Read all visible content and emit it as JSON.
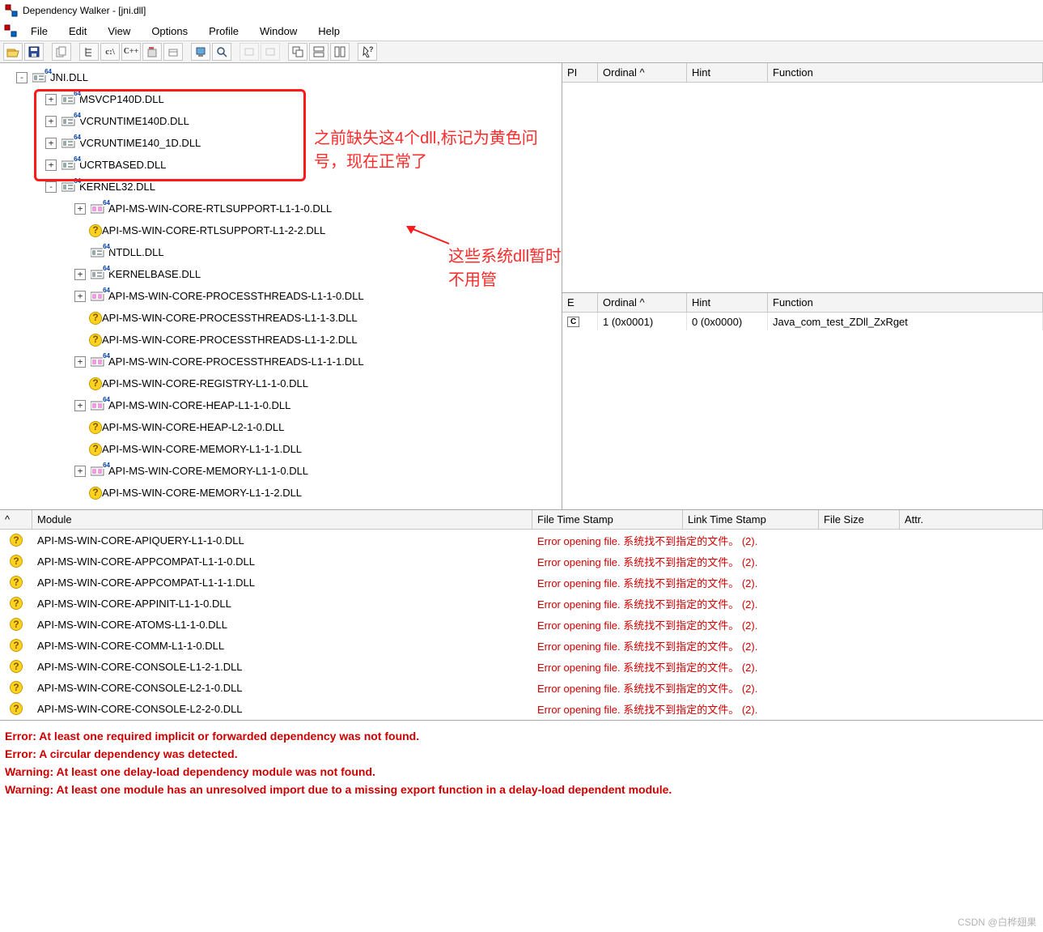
{
  "title": "Dependency Walker - [jni.dll]",
  "menubar": [
    "File",
    "Edit",
    "View",
    "Options",
    "Profile",
    "Window",
    "Help"
  ],
  "tree": [
    {
      "d": 0,
      "exp": "-",
      "icon": "mod64",
      "label": "JNI.DLL"
    },
    {
      "d": 1,
      "exp": "+",
      "icon": "mod64",
      "label": "MSVCP140D.DLL",
      "boxed": true
    },
    {
      "d": 1,
      "exp": "+",
      "icon": "mod64",
      "label": "VCRUNTIME140D.DLL",
      "boxed": true
    },
    {
      "d": 1,
      "exp": "+",
      "icon": "mod64",
      "label": "VCRUNTIME140_1D.DLL",
      "boxed": true
    },
    {
      "d": 1,
      "exp": "+",
      "icon": "mod64",
      "label": "UCRTBASED.DLL",
      "boxed": true
    },
    {
      "d": 1,
      "exp": "-",
      "icon": "mod64",
      "label": "KERNEL32.DLL"
    },
    {
      "d": 2,
      "exp": "+",
      "icon": "link64",
      "label": "API-MS-WIN-CORE-RTLSUPPORT-L1-1-0.DLL"
    },
    {
      "d": 2,
      "exp": " ",
      "icon": "q",
      "label": "API-MS-WIN-CORE-RTLSUPPORT-L1-2-2.DLL"
    },
    {
      "d": 2,
      "exp": " ",
      "icon": "mod64",
      "label": "NTDLL.DLL"
    },
    {
      "d": 2,
      "exp": "+",
      "icon": "mod64",
      "label": "KERNELBASE.DLL"
    },
    {
      "d": 2,
      "exp": "+",
      "icon": "link64",
      "label": "API-MS-WIN-CORE-PROCESSTHREADS-L1-1-0.DLL"
    },
    {
      "d": 2,
      "exp": " ",
      "icon": "q",
      "label": "API-MS-WIN-CORE-PROCESSTHREADS-L1-1-3.DLL"
    },
    {
      "d": 2,
      "exp": " ",
      "icon": "q",
      "label": "API-MS-WIN-CORE-PROCESSTHREADS-L1-1-2.DLL"
    },
    {
      "d": 2,
      "exp": "+",
      "icon": "link64",
      "label": "API-MS-WIN-CORE-PROCESSTHREADS-L1-1-1.DLL"
    },
    {
      "d": 2,
      "exp": " ",
      "icon": "q",
      "label": "API-MS-WIN-CORE-REGISTRY-L1-1-0.DLL"
    },
    {
      "d": 2,
      "exp": "+",
      "icon": "link64",
      "label": "API-MS-WIN-CORE-HEAP-L1-1-0.DLL"
    },
    {
      "d": 2,
      "exp": " ",
      "icon": "q",
      "label": "API-MS-WIN-CORE-HEAP-L2-1-0.DLL"
    },
    {
      "d": 2,
      "exp": " ",
      "icon": "q",
      "label": "API-MS-WIN-CORE-MEMORY-L1-1-1.DLL"
    },
    {
      "d": 2,
      "exp": "+",
      "icon": "link64",
      "label": "API-MS-WIN-CORE-MEMORY-L1-1-0.DLL"
    },
    {
      "d": 2,
      "exp": " ",
      "icon": "q",
      "label": "API-MS-WIN-CORE-MEMORY-L1-1-2.DLL"
    }
  ],
  "annot1": "之前缺失这4个dll,标记为黄色问号，现在正常了",
  "annot2": "这些系统dll暂时不用管",
  "grid_top_cols": [
    "PI",
    "Ordinal ^",
    "Hint",
    "Function"
  ],
  "grid_bot_cols": [
    "E",
    "Ordinal ^",
    "Hint",
    "Function"
  ],
  "grid_bot_row": {
    "e": "C",
    "ordinal": "1 (0x0001)",
    "hint": "0 (0x0000)",
    "func": "Java_com_test_ZDll_ZxRget"
  },
  "mod_cols": [
    "^",
    "Module",
    "File Time Stamp",
    "Link Time Stamp",
    "File Size",
    "Attr."
  ],
  "mod_rows": [
    {
      "name": "API-MS-WIN-CORE-APIQUERY-L1-1-0.DLL",
      "err": "Error opening file. 系统找不到指定的文件。 (2)."
    },
    {
      "name": "API-MS-WIN-CORE-APPCOMPAT-L1-1-0.DLL",
      "err": "Error opening file. 系统找不到指定的文件。 (2)."
    },
    {
      "name": "API-MS-WIN-CORE-APPCOMPAT-L1-1-1.DLL",
      "err": "Error opening file. 系统找不到指定的文件。 (2)."
    },
    {
      "name": "API-MS-WIN-CORE-APPINIT-L1-1-0.DLL",
      "err": "Error opening file. 系统找不到指定的文件。 (2)."
    },
    {
      "name": "API-MS-WIN-CORE-ATOMS-L1-1-0.DLL",
      "err": "Error opening file. 系统找不到指定的文件。 (2)."
    },
    {
      "name": "API-MS-WIN-CORE-COMM-L1-1-0.DLL",
      "err": "Error opening file. 系统找不到指定的文件。 (2)."
    },
    {
      "name": "API-MS-WIN-CORE-CONSOLE-L1-2-1.DLL",
      "err": "Error opening file. 系统找不到指定的文件。 (2)."
    },
    {
      "name": "API-MS-WIN-CORE-CONSOLE-L2-1-0.DLL",
      "err": "Error opening file. 系统找不到指定的文件。 (2)."
    },
    {
      "name": "API-MS-WIN-CORE-CONSOLE-L2-2-0.DLL",
      "err": "Error opening file. 系统找不到指定的文件。 (2)."
    }
  ],
  "log": [
    "Error: At least one required implicit or forwarded dependency was not found.",
    "Error: A circular dependency was detected.",
    "Warning: At least one delay-load dependency module was not found.",
    "Warning: At least one module has an unresolved import due to a missing export function in a delay-load dependent module."
  ],
  "watermark": "CSDN @白桦翅果"
}
